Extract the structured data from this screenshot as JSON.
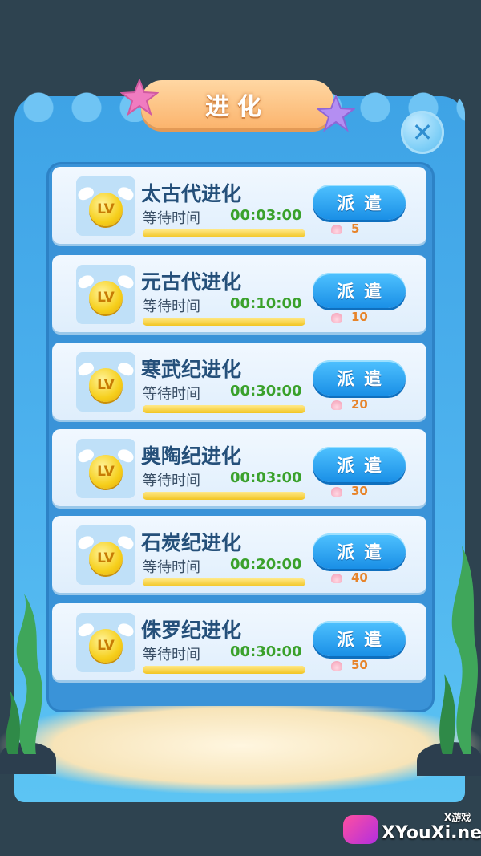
{
  "header": {
    "title": "进化",
    "close_label": "✕"
  },
  "list": {
    "items": [
      {
        "badge": "LV",
        "title": "太古代进化",
        "wait_label": "等待时间",
        "time": "00:03:00",
        "button": "派遣",
        "cost": "5"
      },
      {
        "badge": "LV",
        "title": "元古代进化",
        "wait_label": "等待时间",
        "time": "00:10:00",
        "button": "派遣",
        "cost": "10"
      },
      {
        "badge": "LV",
        "title": "寒武纪进化",
        "wait_label": "等待时间",
        "time": "00:30:00",
        "button": "派遣",
        "cost": "20"
      },
      {
        "badge": "LV",
        "title": "奥陶纪进化",
        "wait_label": "等待时间",
        "time": "00:03:00",
        "button": "派遣",
        "cost": "30"
      },
      {
        "badge": "LV",
        "title": "石炭纪进化",
        "wait_label": "等待时间",
        "time": "00:20:00",
        "button": "派遣",
        "cost": "40"
      },
      {
        "badge": "LV",
        "title": "侏罗纪进化",
        "wait_label": "等待时间",
        "time": "00:30:00",
        "button": "派遣",
        "cost": "50"
      }
    ]
  },
  "watermark": {
    "brand": "XYouXi.net",
    "tag": "X游戏"
  },
  "colors": {
    "panel": "#4fb4ef",
    "title_ribbon": "#fbb46d",
    "button": "#1a8fe6",
    "time_text": "#3aa12b",
    "cost_text": "#e7842a"
  },
  "progress_fill": 1.0
}
